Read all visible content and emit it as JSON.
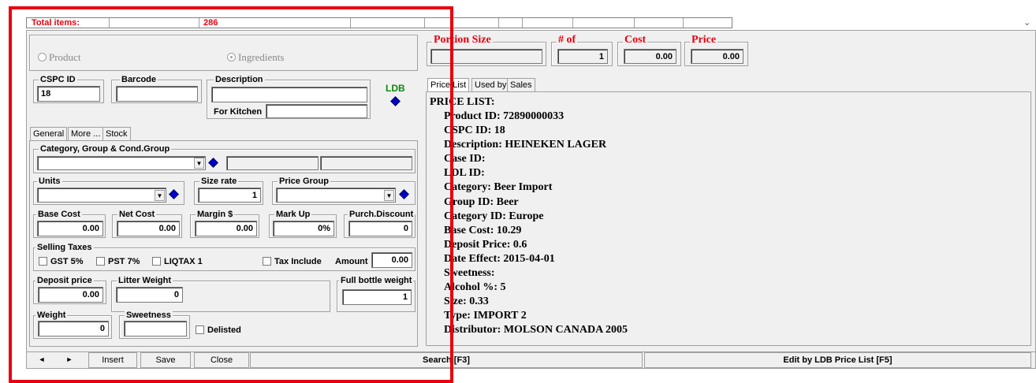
{
  "topbar": {
    "total_label": "Total items:",
    "total_value": "286"
  },
  "mode": {
    "product": "Product",
    "ingredients": "Ingredients"
  },
  "ids": {
    "cspc_label": "CSPC ID",
    "cspc_value": "18",
    "barcode_label": "Barcode",
    "barcode_value": "",
    "description_label": "Description",
    "for_kitchen_label": "For Kitchen",
    "ldb": "LDB"
  },
  "left_tabs": [
    "General",
    "More ...",
    "Stock"
  ],
  "category": {
    "label": "Category, Group & Cond.Group"
  },
  "units": {
    "label": "Units",
    "size_rate_label": "Size rate",
    "size_rate_value": "1",
    "price_group_label": "Price Group"
  },
  "costs": {
    "base_cost_label": "Base Cost",
    "base_cost": "0.00",
    "net_cost_label": "Net Cost",
    "net_cost": "0.00",
    "margin_label": "Margin $",
    "margin": "0.00",
    "markup_label": "Mark Up",
    "markup": "0%",
    "purch_label": "Purch.Discount",
    "purch": "0"
  },
  "taxes": {
    "label": "Selling Taxes",
    "gst": "GST 5%",
    "pst": "PST 7%",
    "liq": "LIQTAX 1",
    "tax_include": "Tax Include",
    "amount_label": "Amount",
    "amount": "0.00"
  },
  "deposit": {
    "deposit_label": "Deposit price",
    "deposit": "0.00",
    "litter_label": "Litter Weight",
    "litter": "0",
    "full_label": "Full bottle weight",
    "full": "1"
  },
  "weight": {
    "weight_label": "Weight",
    "weight": "0",
    "sweetness_label": "Sweetness",
    "delisted": "Delisted"
  },
  "portion": {
    "portion_label": "Portion Size",
    "num_label": "# of",
    "num": "1",
    "cost_label": "Cost",
    "cost": "0.00",
    "price_label": "Price",
    "price": "0.00"
  },
  "right_tabs": [
    "Price List",
    "Used by",
    "Sales"
  ],
  "price_list": {
    "heading": "PRICE LIST:",
    "lines": [
      "Product ID: 72890000033",
      "CSPC ID: 18",
      "Description: HEINEKEN LAGER",
      "Case ID:",
      "LDL ID:",
      "Category: Beer Import",
      "Group ID: Beer",
      "Category ID: Europe",
      "Base Cost: 10.29",
      "Deposit Price: 0.6",
      "Date Effect: 2015-04-01",
      "Sweetness:",
      "Alcohol %: 5",
      "Size: 0.33",
      "Type: IMPORT 2",
      "Distributor: MOLSON CANADA 2005"
    ]
  },
  "bottom": {
    "prev": "◄",
    "next": "►",
    "insert": "Insert",
    "save": "Save",
    "close": "Close",
    "search": "Search [F3]",
    "edit_ldb": "Edit by LDB Price List [F5]"
  },
  "scroll_arrow": "⌄"
}
